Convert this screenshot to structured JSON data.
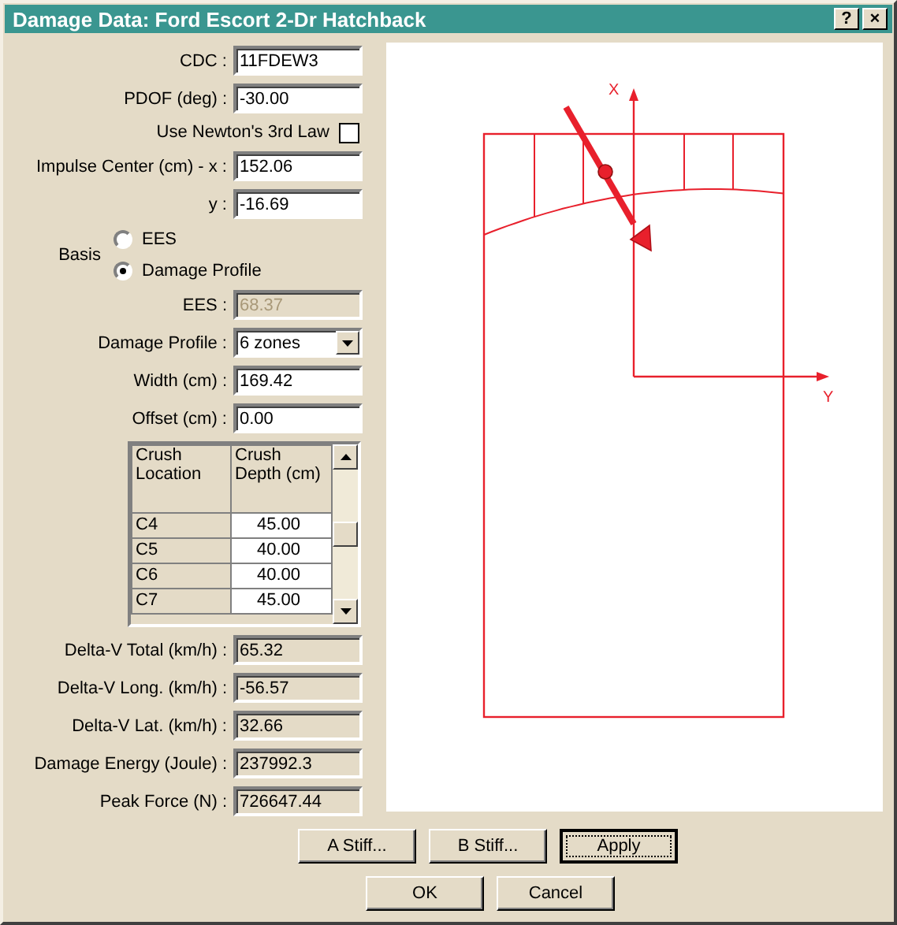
{
  "window": {
    "title": "Damage Data: Ford Escort 2-Dr Hatchback",
    "title_buttons": [
      "?",
      "×"
    ]
  },
  "fields": [
    {
      "kind": "text",
      "label": "CDC :",
      "value": "11FDEW3"
    },
    {
      "kind": "text",
      "label": "PDOF (deg) :",
      "value": "-30.00"
    },
    {
      "kind": "checkbox",
      "label": "Use Newton's 3rd Law",
      "checked": false
    },
    {
      "kind": "text",
      "label": "Impulse Center (cm) - x :",
      "value": "152.06"
    },
    {
      "kind": "text",
      "label": "y :",
      "value": "-16.69"
    },
    {
      "kind": "radio_group",
      "label": "Basis",
      "options": [
        {
          "label": "EES",
          "selected": false
        },
        {
          "label": "Damage Profile",
          "selected": true
        }
      ]
    },
    {
      "kind": "output",
      "label": "EES :",
      "value": "68.37",
      "disabled": true
    },
    {
      "kind": "select",
      "label": "Damage Profile :",
      "value": "6 zones"
    },
    {
      "kind": "text",
      "label": "Width (cm) :",
      "value": "169.42"
    },
    {
      "kind": "text",
      "label": "Offset (cm) :",
      "value": "0.00"
    },
    {
      "kind": "grid",
      "columns": [
        "Crush Location",
        "Crush Depth (cm)"
      ],
      "rows": [
        {
          "location": "C4",
          "depth": "45.00"
        },
        {
          "location": "C5",
          "depth": "40.00"
        },
        {
          "location": "C6",
          "depth": "40.00"
        },
        {
          "location": "C7",
          "depth": "45.00"
        }
      ]
    },
    {
      "kind": "output",
      "label": "Delta-V Total (km/h) :",
      "value": "65.32",
      "disabled": false
    },
    {
      "kind": "output",
      "label": "Delta-V Long. (km/h) :",
      "value": "-56.57",
      "disabled": false
    },
    {
      "kind": "output",
      "label": "Delta-V Lat. (km/h) :",
      "value": "32.66",
      "disabled": false
    },
    {
      "kind": "output",
      "label": "Damage Energy (Joule) :",
      "value": "237992.3",
      "disabled": false
    },
    {
      "kind": "output",
      "label": "Peak Force (N) :",
      "value": "726647.44",
      "disabled": false
    }
  ],
  "diagram": {
    "x_axis_label": "X",
    "y_axis_label": "Y"
  },
  "button_rows": [
    {
      "buttons": [
        {
          "label": "A Stiff...",
          "default": false
        },
        {
          "label": "B Stiff...",
          "default": false
        },
        {
          "label": "Apply",
          "default": true
        }
      ]
    },
    {
      "buttons": [
        {
          "label": "OK",
          "default": false
        },
        {
          "label": "Cancel",
          "default": false
        }
      ]
    }
  ]
}
